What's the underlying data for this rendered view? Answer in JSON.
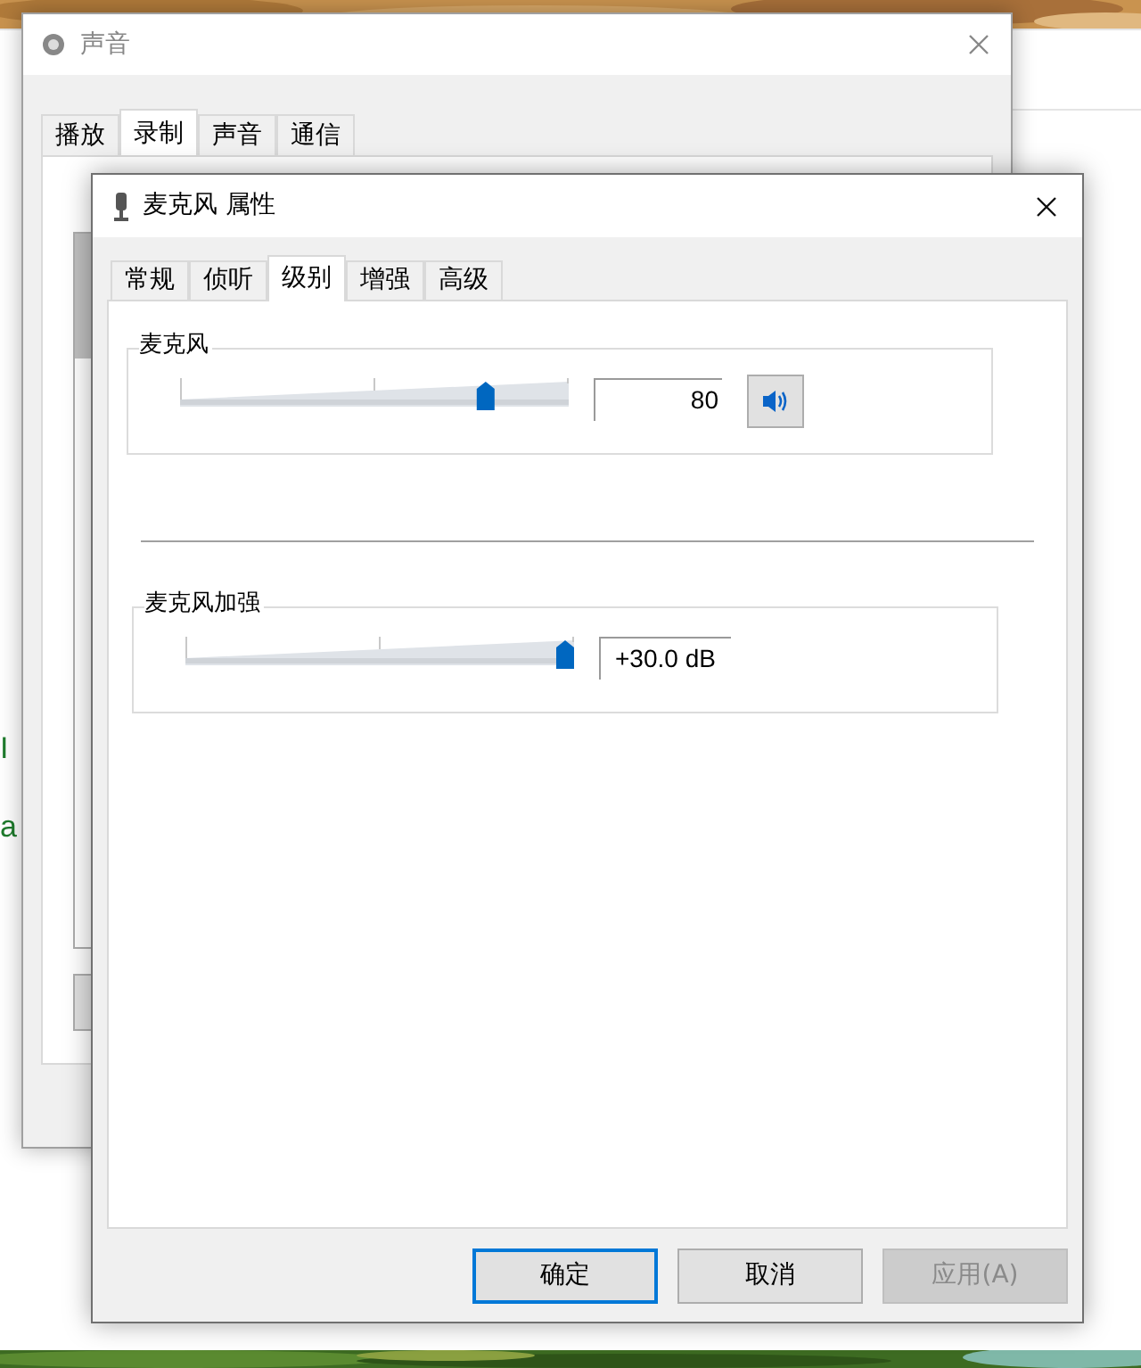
{
  "background_window": {
    "items": [
      {
        "text": "I",
        "kind": "heading"
      },
      {
        "text": "a",
        "kind": "heading"
      }
    ]
  },
  "sound_window": {
    "title": "声音",
    "tabs": [
      {
        "label": "播放",
        "selected": false
      },
      {
        "label": "录制",
        "selected": true
      },
      {
        "label": "声音",
        "selected": false
      },
      {
        "label": "通信",
        "selected": false
      }
    ]
  },
  "properties_dialog": {
    "title": "麦克风 属性",
    "tabs": [
      {
        "label": "常规",
        "selected": false
      },
      {
        "label": "侦听",
        "selected": false
      },
      {
        "label": "级别",
        "selected": true
      },
      {
        "label": "增强",
        "selected": false
      },
      {
        "label": "高级",
        "selected": false
      }
    ],
    "groups": [
      {
        "kind": "volume",
        "title": "麦克风",
        "level": 0.8,
        "value": "80"
      },
      {
        "kind": "boost",
        "title": "麦克风加强",
        "level": 1.0,
        "value": "+30.0 dB"
      }
    ],
    "buttons": [
      {
        "label": "确定",
        "default": true,
        "disabled": false
      },
      {
        "label": "取消",
        "default": false,
        "disabled": false
      },
      {
        "label": "应用(A)",
        "default": false,
        "disabled": true
      }
    ]
  }
}
